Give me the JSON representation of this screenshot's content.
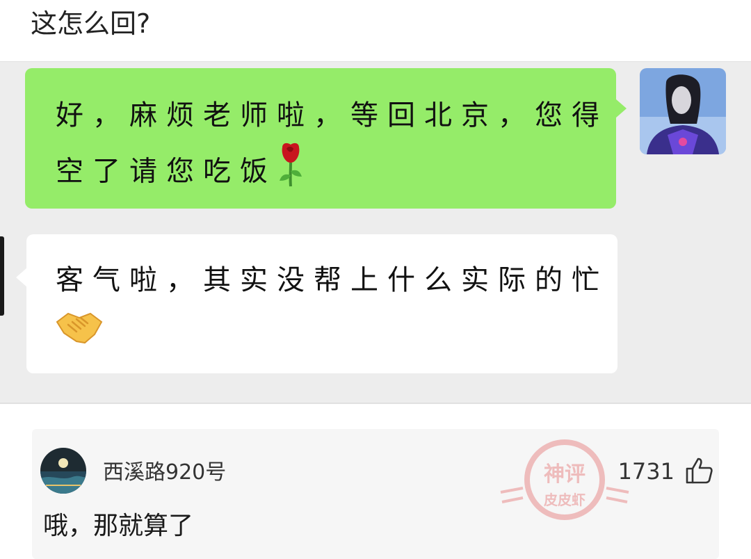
{
  "post": {
    "title": "这怎么回?"
  },
  "chat": {
    "messages": [
      {
        "side": "right",
        "bubble_color": "#95ec69",
        "line1": "好，麻烦老师啦，等回北京，您得",
        "line2": "空了请您吃饭",
        "emoji": "rose-emoji"
      },
      {
        "side": "left",
        "bubble_color": "#ffffff",
        "line1": "客气啦，其实没帮上什么实际的忙",
        "emoji": "handshake-emoji"
      }
    ]
  },
  "comment": {
    "username": "西溪路920号",
    "likes": "1731",
    "text": "哦，那就算了"
  },
  "watermark": {
    "line1": "神评",
    "line2": "皮皮虾",
    "color": "#e04a4a"
  },
  "colors": {
    "chat_bg": "#ededed",
    "sent_bubble": "#95ec69",
    "received_bubble": "#ffffff",
    "comment_bg": "#f6f6f6"
  }
}
